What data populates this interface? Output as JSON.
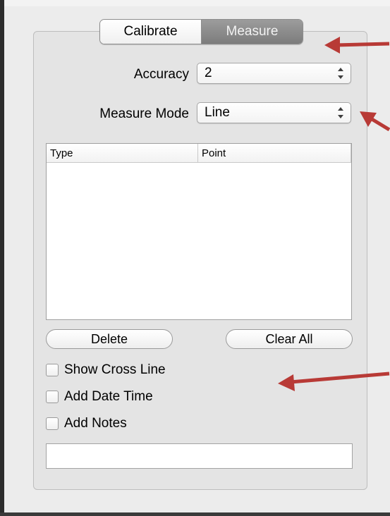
{
  "segmented": {
    "calibrate_label": "Calibrate",
    "measure_label": "Measure",
    "selected": "Measure"
  },
  "accuracy": {
    "label": "Accuracy",
    "value": "2"
  },
  "measure_mode": {
    "label": "Measure Mode",
    "value": "Line"
  },
  "table": {
    "columns": [
      "Type",
      "Point"
    ],
    "rows": []
  },
  "buttons": {
    "delete_label": "Delete",
    "clear_all_label": "Clear All"
  },
  "options": [
    {
      "label": "Show Cross Line",
      "checked": false
    },
    {
      "label": "Add Date Time",
      "checked": false
    },
    {
      "label": "Add Notes",
      "checked": false
    }
  ],
  "notes_field": {
    "value": ""
  },
  "annotation_color": "#b83a36"
}
